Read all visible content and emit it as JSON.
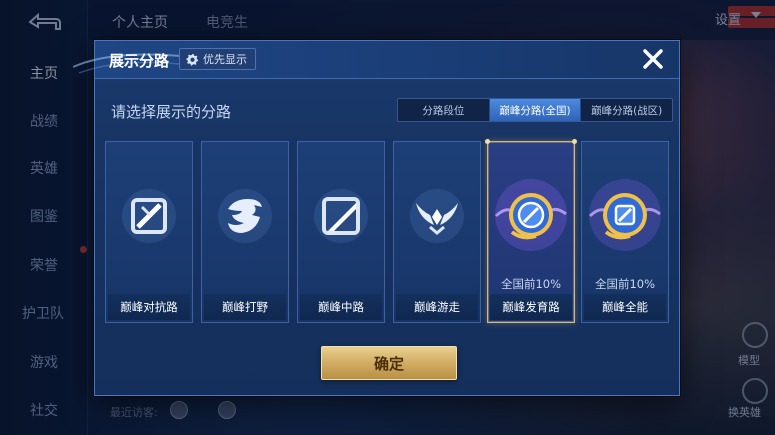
{
  "background": {
    "sidebar": {
      "items": [
        {
          "label": "主页",
          "active": true
        },
        {
          "label": "战绩"
        },
        {
          "label": "英雄"
        },
        {
          "label": "图鉴"
        },
        {
          "label": "荣誉"
        },
        {
          "label": "护卫队"
        },
        {
          "label": "游戏"
        },
        {
          "label": "社交"
        }
      ]
    },
    "top_tabs": [
      "个人主页",
      "电竞生"
    ],
    "settings_label": "设置",
    "visitors_label": "最近访客:",
    "model_label": "模型",
    "swap_hero_label": "换英雄"
  },
  "modal": {
    "title": "展示分路",
    "priority_chip": "优先显示",
    "prompt": "请选择展示的分路",
    "segments": [
      {
        "label": "分路段位",
        "active": false
      },
      {
        "label": "巅峰分路(全国)",
        "active": true
      },
      {
        "label": "巅峰分路(战区)",
        "active": false
      }
    ],
    "cards": [
      {
        "label": "巅峰对抗路",
        "icon": "clash-lane-icon",
        "rank": "",
        "selected": false
      },
      {
        "label": "巅峰打野",
        "icon": "jungle-icon",
        "rank": "",
        "selected": false
      },
      {
        "label": "巅峰中路",
        "icon": "mid-lane-icon",
        "rank": "",
        "selected": false
      },
      {
        "label": "巅峰游走",
        "icon": "roam-icon",
        "rank": "",
        "selected": false
      },
      {
        "label": "巅峰发育路",
        "icon": "farm-lane-icon",
        "rank": "全国前10%",
        "selected": true
      },
      {
        "label": "巅峰全能",
        "icon": "all-round-icon",
        "rank": "全国前10%",
        "selected": false
      }
    ],
    "confirm_label": "确定"
  },
  "colors": {
    "modal_bg": "#173463",
    "accent_blue": "#2f64b8",
    "gold": "#d1ad63",
    "selected_border": "#d7b777"
  }
}
